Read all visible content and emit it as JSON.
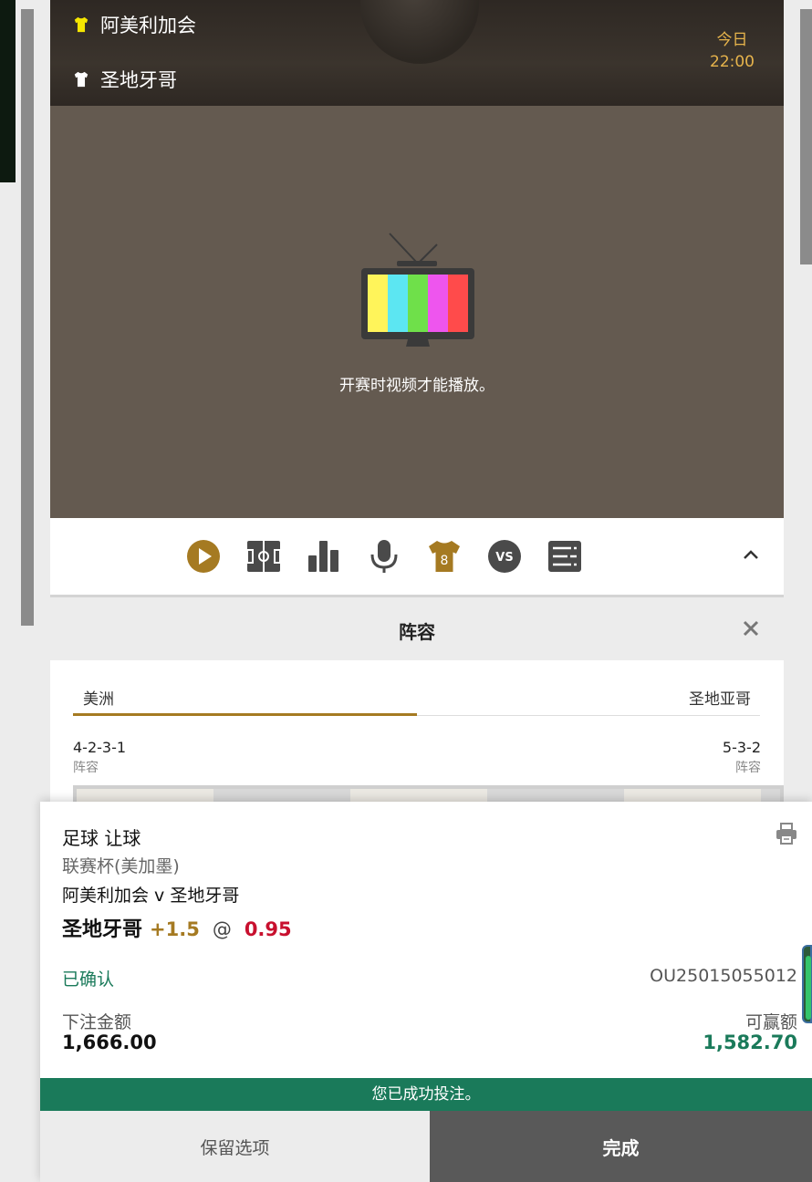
{
  "match": {
    "home_team": "阿美利加会",
    "away_team": "圣地牙哥",
    "kickoff_day": "今日",
    "kickoff_time": "22:00",
    "home_shirt_color": "#f5e600",
    "away_shirt_color": "#ffffff"
  },
  "video": {
    "message": "开赛时视频才能播放。",
    "tv_bar_colors": [
      "#fff45a",
      "#5ce6f2",
      "#6fe04a",
      "#ee55ee",
      "#ff4b4b"
    ]
  },
  "toolbar": {
    "icons": [
      "play-icon",
      "pitch-icon",
      "stats-icon",
      "microphone-icon",
      "shirt-icon",
      "versus-icon",
      "list-icon",
      "chevron-up-icon"
    ],
    "shirt_number": "8",
    "vs_label": "VS",
    "active_color": "#a57a22",
    "icon_color": "#4a4a4a"
  },
  "lineup": {
    "title": "阵容",
    "tab_home": "美洲",
    "tab_away": "圣地亚哥",
    "home_formation": "4-2-3-1",
    "away_formation": "5-3-2",
    "formation_label": "阵容"
  },
  "bet_slip": {
    "sport_market": "足球 让球",
    "competition": "联赛杯(美加墨)",
    "event": "阿美利加会 v 圣地牙哥",
    "selection": "圣地牙哥",
    "handicap": "+1.5",
    "at": "@",
    "odds": "0.95",
    "status": "已确认",
    "reference": "OU25015055012",
    "stake_label": "下注金额",
    "stake_value": "1,666.00",
    "win_label": "可赢额",
    "win_value": "1,582.70",
    "success_message": "您已成功投注。",
    "keep_button": "保留选项",
    "done_button": "完成"
  },
  "colors": {
    "brand_green": "#1a7a5a",
    "gold": "#a57a22",
    "odds_red": "#c8102e"
  }
}
